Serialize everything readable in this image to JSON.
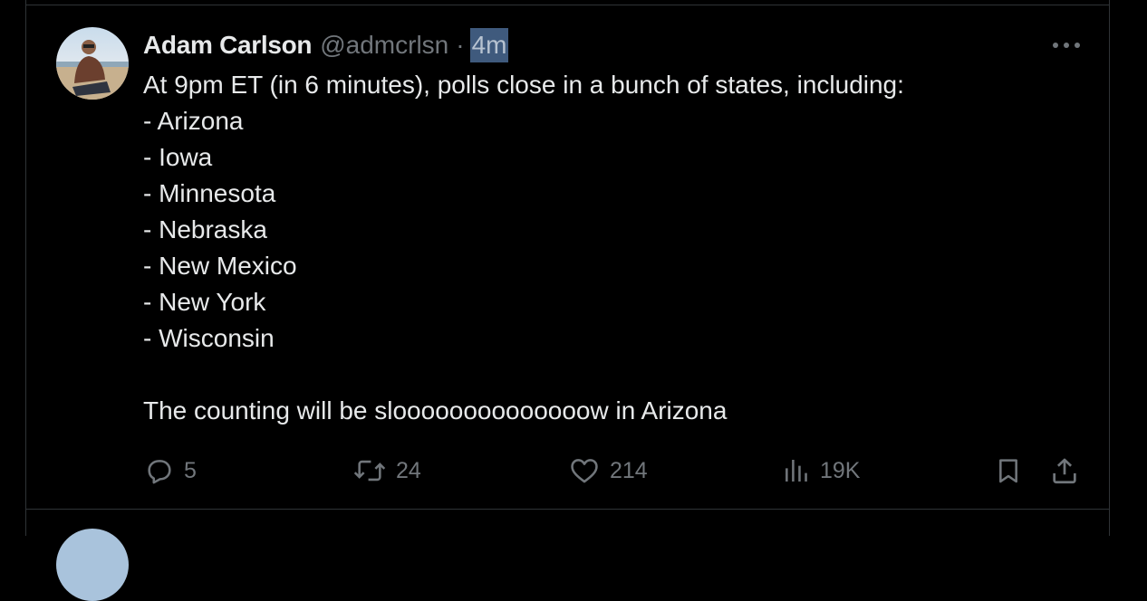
{
  "tweet": {
    "author_name": "Adam Carlson",
    "handle": "@admcrlsn",
    "separator": "·",
    "timestamp": "4m",
    "lines": [
      "At 9pm ET (in 6 minutes), polls close in a bunch of states, including:",
      "- Arizona",
      "- Iowa",
      "- Minnesota",
      "- Nebraska",
      "- New Mexico",
      "- New York",
      "- Wisconsin",
      "",
      "The counting will be sloooooooooooooow in Arizona"
    ],
    "actions": {
      "replies": "5",
      "reposts": "24",
      "likes": "214",
      "views": "19K"
    }
  },
  "icons": {
    "more": "more-horizontal-icon",
    "reply": "reply-icon",
    "repost": "repost-icon",
    "like": "heart-icon",
    "views": "views-chart-icon",
    "bookmark": "bookmark-icon",
    "share": "share-icon"
  },
  "colors": {
    "background": "#000000",
    "text": "#e7e9ea",
    "muted": "#71767b",
    "border": "#2f3336",
    "selection": "#3f5a7d"
  }
}
